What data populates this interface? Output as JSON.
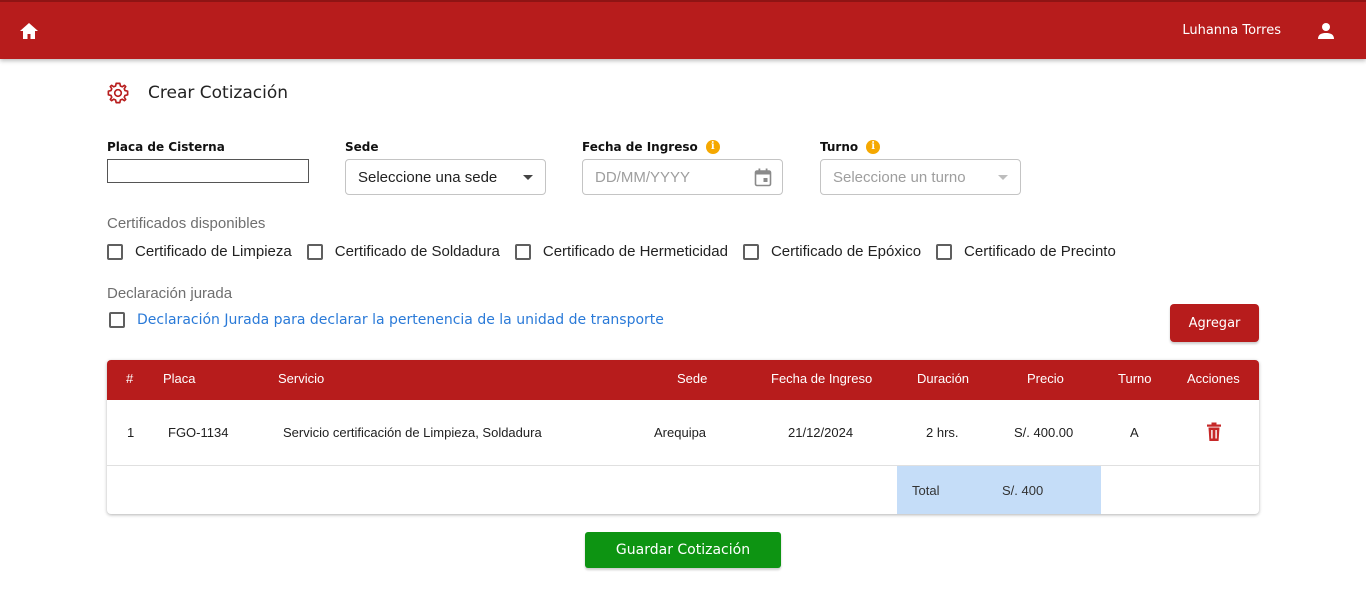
{
  "header": {
    "home_icon": "home-icon",
    "user_name": "Luhanna Torres",
    "user_icon": "person-icon",
    "bg_color": "#b71c1c"
  },
  "page": {
    "title": "Crear Cotización",
    "title_icon": "gear-icon"
  },
  "form": {
    "placa_label": "Placa de Cisterna",
    "placa_value": "",
    "sede_label": "Sede",
    "sede_value": "Seleccione una sede",
    "fecha_label": "Fecha de Ingreso",
    "fecha_placeholder": "DD/MM/YYYY",
    "turno_label": "Turno",
    "turno_value": "Seleccione un turno",
    "info_icon": "info-icon",
    "calendar_icon": "calendar-icon"
  },
  "certificados": {
    "label": "Certificados disponibles",
    "items": [
      {
        "label": "Certificado de Limpieza",
        "checked": false
      },
      {
        "label": "Certificado de Soldadura",
        "checked": false
      },
      {
        "label": "Certificado de Hermeticidad",
        "checked": false
      },
      {
        "label": "Certificado de Epóxico",
        "checked": false
      },
      {
        "label": "Certificado de Precinto",
        "checked": false
      }
    ]
  },
  "declaracion": {
    "label": "Declaración jurada",
    "link_text": "Declaración Jurada para declarar la pertenencia de la unidad de transporte",
    "checked": false
  },
  "buttons": {
    "agregar": "Agregar",
    "guardar": "Guardar Cotización"
  },
  "table": {
    "headers": [
      "#",
      "Placa",
      "Servicio",
      "Sede",
      "Fecha de Ingreso",
      "Duración",
      "Precio",
      "Turno",
      "Acciones"
    ],
    "rows": [
      [
        "1",
        "FGO-1134",
        "Servicio certificación de Limpieza, Soldadura",
        "Arequipa",
        "21/12/2024",
        "2 hrs.",
        "S/. 400.00",
        "A",
        ""
      ]
    ],
    "total_label": "Total",
    "total_value": "S/. 400",
    "delete_icon": "trash-icon"
  },
  "colors": {
    "primary": "#b71c1c",
    "success": "#0d9412",
    "link": "#2a7ad8",
    "info": "#f5a800",
    "total_bg": "#c5ddf8"
  }
}
